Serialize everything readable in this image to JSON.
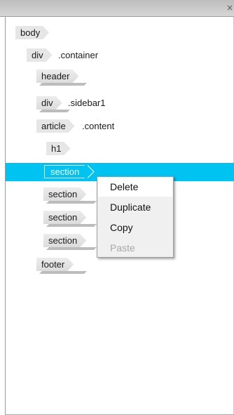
{
  "panel": {
    "close_glyph": "×"
  },
  "tree": [
    {
      "tag": "body",
      "cls": "",
      "selected": false
    },
    {
      "tag": "div",
      "cls": ".container",
      "selected": false
    },
    {
      "tag": "header",
      "cls": "",
      "selected": false
    },
    {
      "tag": "div",
      "cls": ".sidebar1",
      "selected": false
    },
    {
      "tag": "article",
      "cls": ".content",
      "selected": false
    },
    {
      "tag": "h1",
      "cls": "",
      "selected": false
    },
    {
      "tag": "section",
      "cls": "",
      "selected": true
    },
    {
      "tag": "section",
      "cls": "",
      "selected": false
    },
    {
      "tag": "section",
      "cls": "",
      "selected": false
    },
    {
      "tag": "section",
      "cls": "",
      "selected": false
    },
    {
      "tag": "footer",
      "cls": "",
      "selected": false
    }
  ],
  "context_menu": {
    "items": [
      {
        "label": "Delete",
        "state": "hover"
      },
      {
        "label": "Duplicate",
        "state": "normal"
      },
      {
        "label": "Copy",
        "state": "normal"
      },
      {
        "label": "Paste",
        "state": "disabled"
      }
    ]
  },
  "colors": {
    "selection": "#00c3f2",
    "tag_fill": "#e6e6e6",
    "menu_bg": "#f0f0f0",
    "disabled_text": "#a8a8a8"
  }
}
